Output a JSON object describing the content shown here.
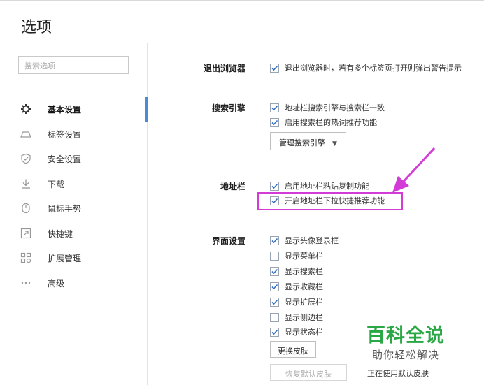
{
  "header": {
    "title": "选项"
  },
  "sidebar": {
    "search_placeholder": "搜索选项",
    "items": [
      {
        "label": "基本设置",
        "icon": "gear-icon",
        "active": true
      },
      {
        "label": "标签设置",
        "icon": "tab-icon"
      },
      {
        "label": "安全设置",
        "icon": "shield-icon"
      },
      {
        "label": "下载",
        "icon": "download-icon"
      },
      {
        "label": "鼠标手势",
        "icon": "mouse-icon"
      },
      {
        "label": "快捷键",
        "icon": "shortcut-icon"
      },
      {
        "label": "扩展管理",
        "icon": "extensions-icon"
      },
      {
        "label": "高级",
        "icon": "more-icon"
      }
    ]
  },
  "sections": {
    "exit": {
      "title": "退出浏览器",
      "options": [
        {
          "label": "退出浏览器时，若有多个标签页打开则弹出警告提示",
          "checked": true
        }
      ]
    },
    "search": {
      "title": "搜索引擎",
      "options": [
        {
          "label": "地址栏搜索引擎与搜索栏一致",
          "checked": true
        },
        {
          "label": "启用搜索栏的热词推荐功能",
          "checked": true
        }
      ],
      "manage_button": "管理搜索引擎"
    },
    "address": {
      "title": "地址栏",
      "options": [
        {
          "label": "启用地址栏粘贴复制功能",
          "checked": true
        },
        {
          "label": "开启地址栏下拉快捷推荐功能",
          "checked": true
        }
      ]
    },
    "ui": {
      "title": "界面设置",
      "options": [
        {
          "label": "显示头像登录框",
          "checked": true
        },
        {
          "label": "显示菜单栏",
          "checked": false
        },
        {
          "label": "显示搜索栏",
          "checked": true
        },
        {
          "label": "显示收藏栏",
          "checked": true
        },
        {
          "label": "显示扩展栏",
          "checked": true
        },
        {
          "label": "显示侧边栏",
          "checked": false
        },
        {
          "label": "显示状态栏",
          "checked": true
        }
      ],
      "change_skin_button": "更换皮肤",
      "restore_skin_button": "恢复默认皮肤",
      "skin_status": "正在使用默认皮肤"
    }
  },
  "watermark": {
    "title": "百科全说",
    "subtitle": "助你轻松解决"
  },
  "colors": {
    "accent": "#4a8bd8",
    "highlight": "#d23bd6",
    "watermark": "#2aa845"
  }
}
